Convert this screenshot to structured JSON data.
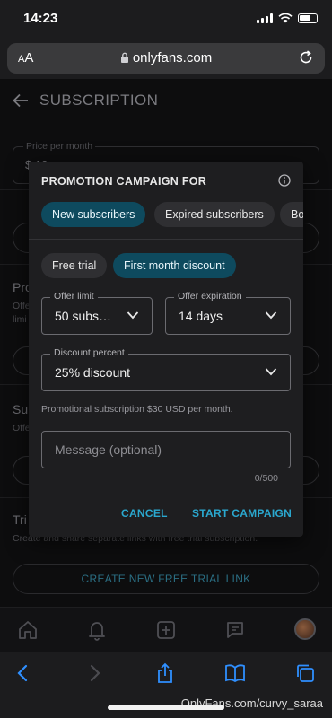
{
  "status": {
    "time": "14:23"
  },
  "browser": {
    "text_size_label": "AA",
    "url": "onlyfans.com"
  },
  "page": {
    "title": "SUBSCRIPTION",
    "price_label": "Price per month",
    "price_value": "$ 10",
    "promo_heading": "Pro",
    "promo_sub_1": "Offe",
    "promo_sub_2": "limi",
    "sub_heading": "Su",
    "sub_sub": "Offe",
    "trial_heading": "Tri",
    "trial_desc": "Create and share separate links with free trial subscription.",
    "create_link_label": "CREATE NEW FREE TRIAL LINK"
  },
  "modal": {
    "title": "PROMOTION CAMPAIGN FOR",
    "audience_chips": [
      "New subscribers",
      "Expired subscribers",
      "Bo"
    ],
    "type_chips": [
      "Free trial",
      "First month discount"
    ],
    "offer_limit": {
      "label": "Offer limit",
      "value": "50 subs…"
    },
    "offer_expiration": {
      "label": "Offer expiration",
      "value": "14 days"
    },
    "discount": {
      "label": "Discount percent",
      "value": "25% discount"
    },
    "helper_text": "Promotional subscription $30 USD per month.",
    "message_placeholder": "Message (optional)",
    "char_counter": "0/500",
    "cancel_label": "CANCEL",
    "start_label": "START CAMPAIGN"
  },
  "watermark": "OnlyFans.com/curvy_saraa",
  "colors": {
    "accent": "#2aa8cf",
    "chip_active": "#0e4a5e",
    "modal_bg": "#1e1e20"
  }
}
